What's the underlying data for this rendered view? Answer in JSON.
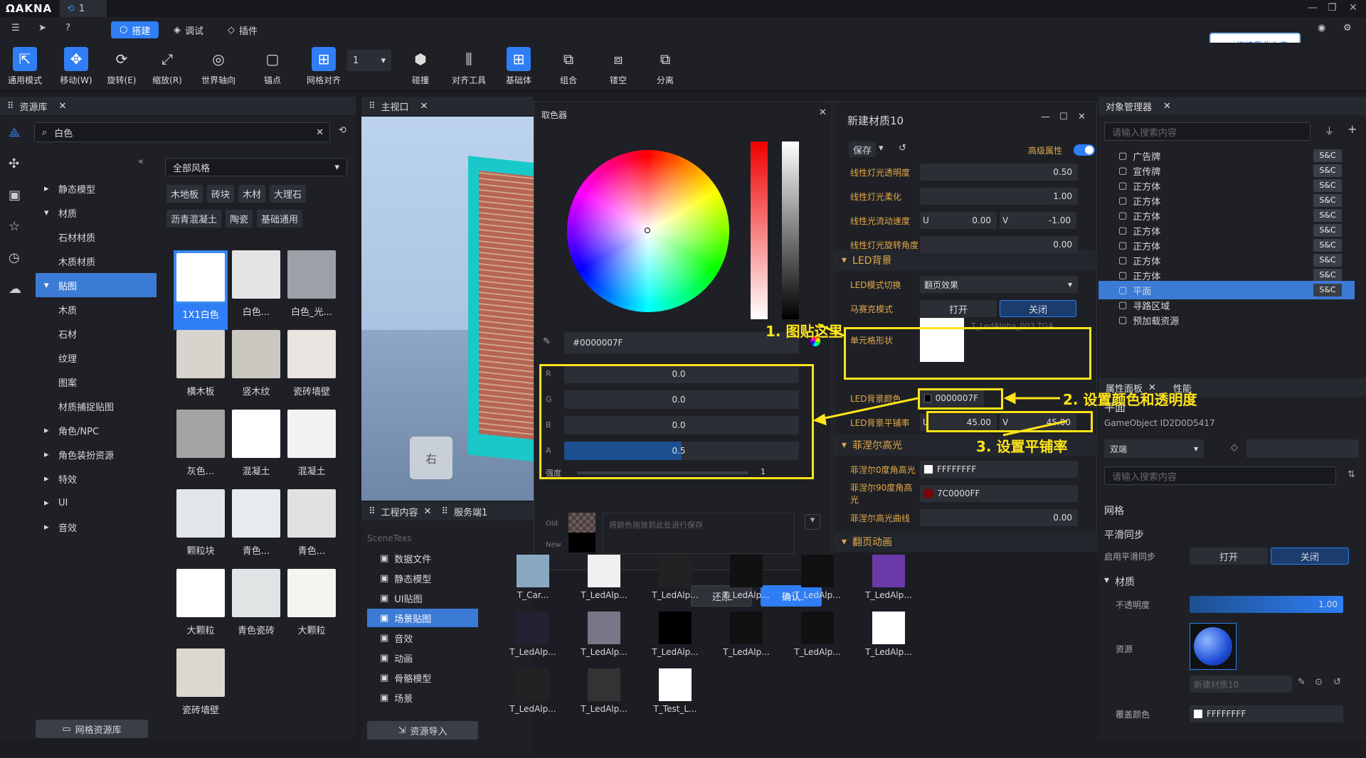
{
  "titlebar": {
    "logo": "ΩΑΚΝΑ",
    "tab": "1"
  },
  "modes": {
    "build": "搭建",
    "debug": "调试",
    "plugin": "插件"
  },
  "upload": "拖拽至此上传",
  "tools": [
    {
      "icon": "cursor-icon",
      "label": "通用模式"
    },
    {
      "icon": "move-icon",
      "label": "移动(W)"
    },
    {
      "icon": "rotate-icon",
      "label": "旋转(E)"
    },
    {
      "icon": "scale-icon",
      "label": "缩放(R)"
    },
    {
      "icon": "world-axis-icon",
      "label": "世界轴向"
    },
    {
      "icon": "anchor-icon",
      "label": "锚点"
    },
    {
      "icon": "grid-snap-icon",
      "label": "网格对齐"
    },
    {
      "icon": "collision-icon",
      "label": "碰撞"
    },
    {
      "icon": "align-icon",
      "label": "对齐工具"
    },
    {
      "icon": "basic-shape-icon",
      "label": "基础体"
    },
    {
      "icon": "combine-icon",
      "label": "组合"
    },
    {
      "icon": "hollow-icon",
      "label": "镂空"
    },
    {
      "icon": "split-icon",
      "label": "分离"
    }
  ],
  "grid_value": "1",
  "resource": {
    "title": "资源库",
    "search": "白色",
    "filter": "全部风格",
    "chips": [
      "木地板",
      "砖块",
      "木材",
      "大理石",
      "沥青混凝土",
      "陶瓷",
      "基础通用"
    ],
    "tree": [
      {
        "label": "静态模型",
        "arrow": "▸"
      },
      {
        "label": "材质",
        "arrow": "▾"
      },
      {
        "label": "石材材质",
        "arrow": ""
      },
      {
        "label": "木质材质",
        "arrow": ""
      },
      {
        "label": "贴图",
        "arrow": "▾"
      },
      {
        "label": "木质",
        "arrow": ""
      },
      {
        "label": "石材",
        "arrow": ""
      },
      {
        "label": "纹理",
        "arrow": ""
      },
      {
        "label": "图案",
        "arrow": ""
      },
      {
        "label": "材质捕捉贴图",
        "arrow": ""
      },
      {
        "label": "角色/NPC",
        "arrow": "▸"
      },
      {
        "label": "角色装扮资源",
        "arrow": "▸"
      },
      {
        "label": "特效",
        "arrow": "▸"
      },
      {
        "label": "UI",
        "arrow": "▸"
      },
      {
        "label": "音效",
        "arrow": "▸"
      }
    ],
    "thumbs": [
      "1X1白色",
      "白色...",
      "白色_光...",
      "横木板",
      "竖木纹",
      "瓷砖墙壁",
      "灰色...",
      "混凝土",
      "混凝土",
      "颗粒块",
      "青色...",
      "青色...",
      "大颗粒",
      "青色瓷砖",
      "大颗粒",
      "瓷砖墙壁"
    ],
    "footer": "网格资源库"
  },
  "viewport": {
    "title": "主视口",
    "cube_label": "右"
  },
  "picker": {
    "title": "取色器",
    "hex": "#0000007F",
    "r": "0.0",
    "g": "0.0",
    "b": "0.0",
    "a": "0.5",
    "intensity_label": "强度",
    "intensity": "1",
    "old": "Old",
    "new": "New",
    "save_hint": "将颜色拖放到此处进行保存",
    "reset": "还原",
    "confirm": "确认"
  },
  "material": {
    "title": "新建材质10",
    "save": "保存",
    "advanced": "高级属性",
    "rows": [
      {
        "label": "线性灯光透明度",
        "value": "0.50"
      },
      {
        "label": "线性灯光柔化",
        "value": "1.00"
      },
      {
        "label": "线性光流动速度",
        "u": "0.00",
        "v": "-1.00"
      },
      {
        "label": "线性灯光旋转角度",
        "value": "0.00"
      }
    ],
    "led_section": "LED背景",
    "led_mode_label": "LED模式切换",
    "led_mode": "翻页效果",
    "mosaic_label": "马赛克模式",
    "open": "打开",
    "close": "关闭",
    "cell_label": "单元格形状",
    "cell_texture": "T_LedAlpha_003.TGA",
    "bg_color_label": "LED背景颜色",
    "bg_color": "0000007F",
    "tile_label": "LED背景平铺率",
    "tile_u": "45.00",
    "tile_v": "45.00",
    "fresnel_section": "菲涅尔高光",
    "f0_label": "菲涅尔0度角高光",
    "f0": "FFFFFFFF",
    "f90_label": "菲涅尔90度角高光",
    "f90": "7C0000FF",
    "fcurve_label": "菲涅尔高光曲线",
    "fcurve": "0.00",
    "flip_section": "翻页动画"
  },
  "annotations": {
    "a1": "1. 图贴这里",
    "a2": "2. 设置颜色和透明度",
    "a3": "3. 设置平铺率"
  },
  "objects": {
    "title": "对象管理器",
    "search": "请输入搜索内容",
    "items": [
      {
        "label": "广告牌",
        "tag": "S&C"
      },
      {
        "label": "宣传牌",
        "tag": "S&C"
      },
      {
        "label": "正方体",
        "tag": "S&C"
      },
      {
        "label": "正方体",
        "tag": "S&C"
      },
      {
        "label": "正方体",
        "tag": "S&C"
      },
      {
        "label": "正方体",
        "tag": "S&C"
      },
      {
        "label": "正方体",
        "tag": "S&C"
      },
      {
        "label": "正方体",
        "tag": "S&C"
      },
      {
        "label": "正方体",
        "tag": "S&C"
      },
      {
        "label": "平面",
        "tag": "S&C"
      },
      {
        "label": "寻路区域",
        "tag": ""
      },
      {
        "label": "预加载资源",
        "tag": ""
      }
    ]
  },
  "props": {
    "tab1": "属性面板",
    "tab2": "性能",
    "name": "平面",
    "gid": "GameObject ID2D0D5417",
    "side": "双端",
    "search": "请输入搜索内容",
    "network": "网格",
    "smooth": "平滑同步",
    "smooth_enable": "启用平滑同步",
    "open": "打开",
    "close": "关闭",
    "material": "材质",
    "opacity_label": "不透明度",
    "opacity": "1.00",
    "resource_label": "资源",
    "mat_name": "新建材质10",
    "cover_label": "覆盖颜色",
    "cover": "FFFFFFFF"
  },
  "project": {
    "tab1": "工程内容",
    "tab2": "服务端1",
    "scene": "SceneTexs",
    "items": [
      "数据文件",
      "静态模型",
      "UI贴图",
      "场景贴图",
      "音效",
      "动画",
      "骨骼模型",
      "场景"
    ],
    "import": "资源导入"
  },
  "assets": [
    "T_Car...",
    "T_LedAlp...",
    "T_LedAlp...",
    "T_LedAlp...",
    "T_LedAlp...",
    "T_LedAlp...",
    "T_LedAlp...",
    "T_LedAlp...",
    "T_LedAlp...",
    "T_LedAlp...",
    "T_LedAlp...",
    "T_LedAlp...",
    "T_LedAlp...",
    "T_LedAlp...",
    "T_Test_L..."
  ]
}
